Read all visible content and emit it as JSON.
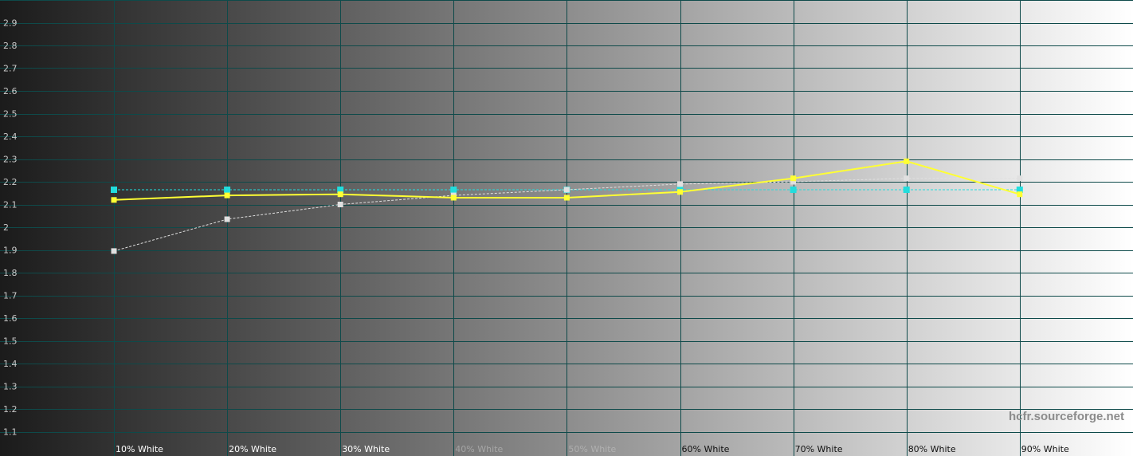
{
  "watermark": "hcfr.sourceforge.net",
  "chart_data": {
    "type": "line",
    "categories": [
      "10% White",
      "20% White",
      "30% White",
      "40% White",
      "50% White",
      "60% White",
      "70% White",
      "80% White",
      "90% White"
    ],
    "ylim": [
      1.0,
      3.0
    ],
    "yticks": [
      "1.1",
      "1.2",
      "1.3",
      "1.4",
      "1.5",
      "1.6",
      "1.7",
      "1.8",
      "1.9",
      "2",
      "2.1",
      "2.2",
      "2.3",
      "2.4",
      "2.5",
      "2.6",
      "2.7",
      "2.8",
      "2.9"
    ],
    "grid": true,
    "series": [
      {
        "values": [
          2.12,
          2.14,
          2.145,
          2.13,
          2.13,
          2.155,
          2.215,
          2.29,
          2.145
        ],
        "color": "#ffff33",
        "style": "solid"
      },
      {
        "values": [
          1.895,
          2.035,
          2.1,
          2.14,
          2.165,
          2.19,
          2.2,
          2.215,
          2.215
        ],
        "color": "#e0e0e0",
        "style": "dashed"
      },
      {
        "values": [
          2.165,
          2.165,
          2.165,
          2.165,
          2.165,
          2.165,
          2.165,
          2.165,
          2.165
        ],
        "color": "#22dddd",
        "style": "dashed"
      }
    ],
    "colors": {
      "background_dark": "#1b1b1b",
      "background_light": "#ffffff",
      "grid": "#0e4a4a"
    }
  }
}
